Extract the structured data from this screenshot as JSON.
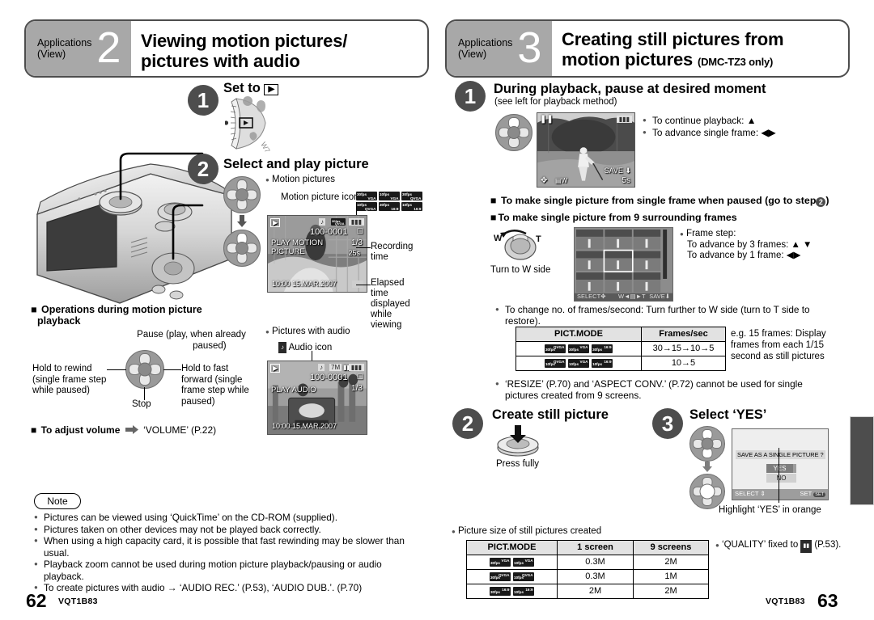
{
  "left_page": {
    "banner": {
      "applications": "Applications",
      "view": "(View)",
      "number": "2",
      "title_line1": "Viewing motion pictures/",
      "title_line2": "pictures with audio"
    },
    "step1": {
      "number": "1",
      "title": "Set to",
      "icon": "play-mode-icon"
    },
    "step2": {
      "number": "2",
      "title": "Select and play picture",
      "bullet_motion": "Motion pictures",
      "motion_picture_icon_label": "Motion picture icon",
      "fps_icons": [
        {
          "top": "30fps",
          "bottom": "VGA"
        },
        {
          "top": "10fps",
          "bottom": "VGA"
        },
        {
          "top": "30fps",
          "bottom": "QVGA"
        },
        {
          "top": "10fps",
          "bottom": "QVGA"
        },
        {
          "top": "30fps",
          "bottom": "16:9"
        },
        {
          "top": "10fps",
          "bottom": "16:9"
        }
      ],
      "lcd_motion": {
        "mode_icon": "playback-icon",
        "file_no": "100-0001",
        "counter": "1/3",
        "message_line1": "PLAY MOTION",
        "message_line2": "PICTURE",
        "rec_time": "25s",
        "datetime": "10:00  15.MAR.2007"
      },
      "callout_recording_time": "Recording\ntime",
      "callout_elapsed": "Elapsed\ntime\ndisplayed\nwhile\nviewing",
      "bullet_audio": "Pictures with audio",
      "audio_icon_label": "Audio icon",
      "lcd_audio": {
        "mode_icon": "playback-icon",
        "size_icon": "7M",
        "file_no": "100-0001",
        "counter": "1/3",
        "message": "PLAY AUDIO",
        "datetime": "10:00  15.MAR.2007"
      }
    },
    "operations": {
      "heading_line1": "Operations during motion picture",
      "heading_line2": "playback",
      "up": "Pause (play, when already\npaused)",
      "left": "Hold to rewind\n(single frame step\nwhile paused)",
      "right": "Hold to fast\nforward (single\nframe step while\npaused)",
      "down": "Stop"
    },
    "volume_line": {
      "label": "To adjust volume",
      "arrow": "arrow-right-icon",
      "target": "‘VOLUME’ (P.22)"
    },
    "note": {
      "title": "Note",
      "items": [
        "Pictures can be viewed using ‘QuickTime’ on the CD-ROM (supplied).",
        "Pictures taken on other devices may not be played back correctly.",
        "When using a high capacity card, it is possible that fast rewinding may be slower than usual.",
        "Playback zoom cannot be used during motion picture playback/pausing or audio playback.",
        "To create pictures with audio → ‘AUDIO REC.’ (P.53), ‘AUDIO DUB.’. (P.70)"
      ]
    },
    "footer": {
      "page": "62",
      "code": "VQT1B83"
    }
  },
  "right_page": {
    "banner": {
      "applications": "Applications",
      "view": "(View)",
      "number": "3",
      "title_line1": "Creating still pictures from",
      "title_line2": "motion pictures",
      "title_sub": "(DMC-TZ3 only)"
    },
    "step1": {
      "number": "1",
      "title": "During playback, pause at desired moment",
      "subtitle": "(see left for playback method)",
      "lcd": {
        "pause_icon": "pause-icon",
        "battery_icon": "battery-icon",
        "save_label": "SAVE",
        "zoom_label": "W",
        "time": "5s"
      },
      "bullets": [
        "To continue playback: ▲",
        "To advance single frame: ◀▶"
      ]
    },
    "single_frame_heading": "To make single picture from single frame when paused (go to step",
    "single_frame_heading_tail": ")",
    "single_frame_step_circle": "2",
    "nine_frames_heading": "To make single picture from 9 surrounding frames",
    "zoom_lever": {
      "w": "W",
      "t": "T",
      "caption": "Turn to W side"
    },
    "grid_screen": {
      "footer_select": "SELECT",
      "footer_zoom": "W       T",
      "footer_save": "SAVE"
    },
    "frame_step": {
      "title": "Frame step:",
      "line1": "To advance by 3 frames: ▲ ▼",
      "line2": "To advance by 1 frame:  ◀▶"
    },
    "frames_note": "To change no. of frames/second: Turn further to W side (turn to T side to restore).",
    "fps_table": {
      "headers": [
        "PICT.MODE",
        "Frames/sec"
      ],
      "rows": [
        {
          "icons": [
            {
              "top": "30fps",
              "bottom": "QVGA"
            },
            {
              "top": "30fps",
              "bottom": "VGA"
            },
            {
              "top": "30fps",
              "bottom": "16:9"
            }
          ],
          "value": "30→15→10→5"
        },
        {
          "icons": [
            {
              "top": "10fps",
              "bottom": "QVGA"
            },
            {
              "top": "10fps",
              "bottom": "VGA"
            },
            {
              "top": "10fps",
              "bottom": "16:9"
            }
          ],
          "value": "10→5"
        }
      ],
      "side_note": "e.g. 15 frames: Display frames from each 1/15 second as still pictures"
    },
    "resize_note": "‘RESIZE’ (P.70) and ‘ASPECT CONV.’ (P.72) cannot be used for single pictures created from 9 screens.",
    "step2": {
      "number": "2",
      "title": "Create still picture",
      "caption": "Press fully"
    },
    "step3": {
      "number": "3",
      "title": "Select ‘YES’",
      "dialog": {
        "prompt": "SAVE AS A SINGLE PICTURE ?",
        "yes": "YES",
        "no": "NO",
        "footer_select": "SELECT",
        "footer_set": "SET",
        "footer_set_icon": "MENU/SET"
      },
      "callout": "Highlight ‘YES’ in orange"
    },
    "size_table": {
      "caption": "Picture size of still pictures created",
      "headers": [
        "PICT.MODE",
        "1 screen",
        "9 screens"
      ],
      "rows": [
        {
          "icons": [
            {
              "top": "30fps",
              "bottom": "VGA"
            },
            {
              "top": "10fps",
              "bottom": "VGA"
            }
          ],
          "one": "0.3M",
          "nine": "2M"
        },
        {
          "icons": [
            {
              "top": "30fps",
              "bottom": "QVGA"
            },
            {
              "top": "10fps",
              "bottom": "QVGA"
            }
          ],
          "one": "0.3M",
          "nine": "1M"
        },
        {
          "icons": [
            {
              "top": "30fps",
              "bottom": "16:9"
            },
            {
              "top": "10fps",
              "bottom": "16:9"
            }
          ],
          "one": "2M",
          "nine": "2M"
        }
      ]
    },
    "quality_note_pre": "‘QUALITY’ fixed to",
    "quality_note_post": "(P.53).",
    "footer": {
      "code": "VQT1B83",
      "page": "63"
    }
  }
}
